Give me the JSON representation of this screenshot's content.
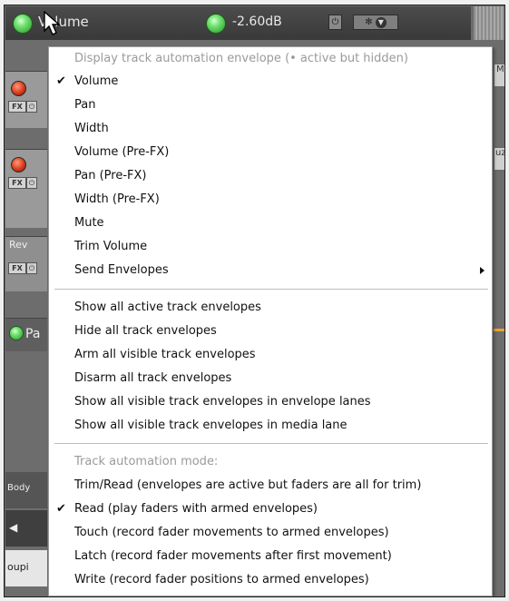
{
  "envelope_header": {
    "name": "Volume",
    "value": "-2.60dB"
  },
  "track_labels": {
    "rev": "Rev",
    "pa": "Pa",
    "body": "Body",
    "coupi": "oupi"
  },
  "right_labels": {
    "r1": "M",
    "r2": "uz"
  },
  "menu": {
    "header": "Display track automation envelope (• active but hidden)",
    "items": [
      {
        "label": "Volume",
        "checked": true
      },
      {
        "label": "Pan"
      },
      {
        "label": "Width"
      },
      {
        "label": "Volume (Pre-FX)"
      },
      {
        "label": "Pan (Pre-FX)"
      },
      {
        "label": "Width (Pre-FX)"
      },
      {
        "label": "Mute"
      },
      {
        "label": "Trim Volume"
      },
      {
        "label": "Send Envelopes",
        "submenu": true
      }
    ],
    "section2": [
      {
        "label": "Show all active track envelopes"
      },
      {
        "label": "Hide all track envelopes"
      },
      {
        "label": "Arm all visible track envelopes"
      },
      {
        "label": "Disarm all track envelopes"
      },
      {
        "label": "Show all visible track envelopes in envelope lanes"
      },
      {
        "label": "Show all visible track envelopes in media lane"
      }
    ],
    "mode_header": "Track automation mode:",
    "modes": [
      {
        "label": "Trim/Read (envelopes are active but faders are all for trim)"
      },
      {
        "label": "Read (play faders with armed envelopes)",
        "checked": true
      },
      {
        "label": "Touch (record fader movements to armed envelopes)"
      },
      {
        "label": "Latch (record fader movements after first movement)"
      },
      {
        "label": "Write (record fader positions to armed envelopes)"
      }
    ]
  },
  "check_mark": "✔",
  "colors": {
    "menu_bg": "#ffffff",
    "disabled_text": "#9a9a9a",
    "knob_green": "#6fe36f",
    "header_bg": "#444444"
  }
}
